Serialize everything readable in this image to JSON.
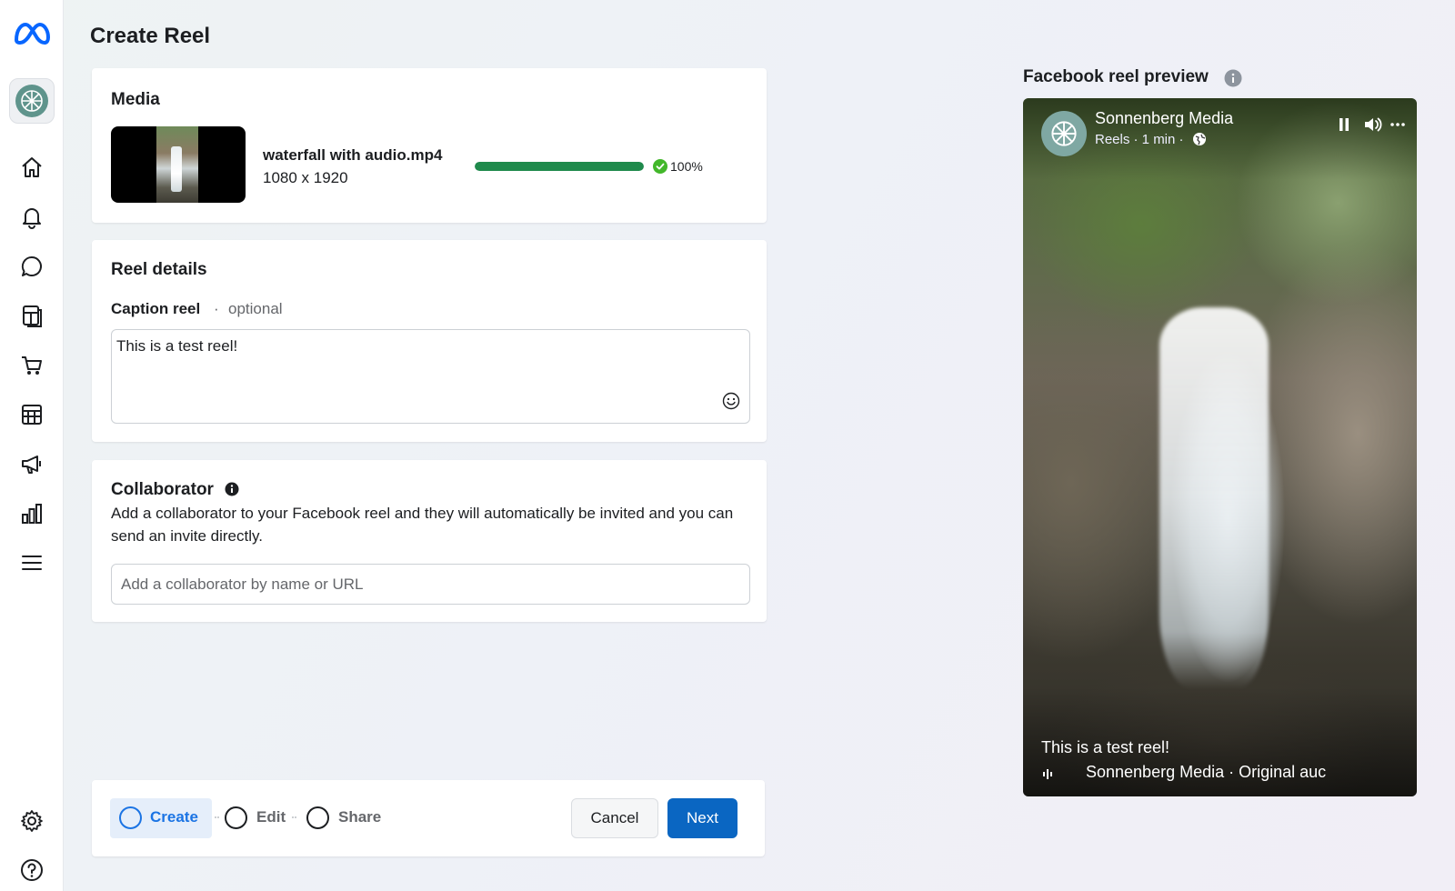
{
  "page": {
    "title": "Create Reel"
  },
  "media": {
    "title": "Media",
    "file_name": "waterfall with audio.mp4",
    "dimensions": "1080 x 1920",
    "progress_percent": 100,
    "progress_text": "100%"
  },
  "details": {
    "title": "Reel details",
    "caption_label": "Caption reel",
    "caption_dot": "·",
    "caption_optional": "optional",
    "caption_value": "This is a test reel!"
  },
  "collaborator": {
    "title": "Collaborator",
    "description": "Add a collaborator to your Facebook reel and they will automatically be invited and you can send an invite directly.",
    "input_placeholder": "Add a collaborator by name or URL"
  },
  "steps": {
    "items": [
      {
        "label": "Create",
        "active": true
      },
      {
        "label": "Edit",
        "active": false
      },
      {
        "label": "Share",
        "active": false
      }
    ],
    "cancel_label": "Cancel",
    "next_label": "Next"
  },
  "preview": {
    "title": "Facebook reel preview",
    "page_name": "Sonnenberg Media",
    "meta": "Reels · 1 min ·",
    "caption": "This is a test reel!",
    "audio": "Sonnenberg Media · Original auc"
  },
  "icons": {
    "rail": [
      "meta-logo-icon",
      "page-avatar-icon",
      "home-icon",
      "bell-icon",
      "chat-bubble-icon",
      "pages-icon",
      "cart-icon",
      "table-grid-icon",
      "megaphone-icon",
      "bar-chart-icon",
      "menu-icon",
      "gear-icon",
      "help-icon"
    ]
  },
  "colors": {
    "accent": "#1b74e4",
    "primary_button": "#0a66c2",
    "progress": "#1f8a4c",
    "success": "#42b72a"
  }
}
